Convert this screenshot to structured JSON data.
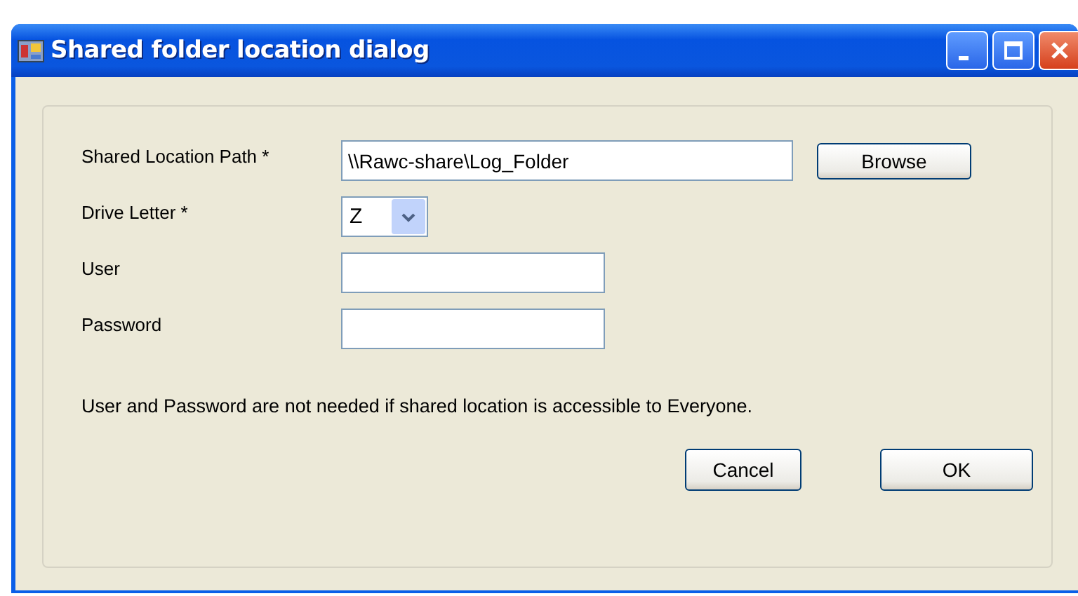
{
  "window": {
    "title": "Shared folder location dialog"
  },
  "fields": [
    {
      "label": "Shared Location Path *",
      "kind": "text",
      "value": "\\\\Rawc-share\\Log_Folder",
      "button": "Browse"
    },
    {
      "label": "Drive Letter *",
      "kind": "dropdown",
      "value": "Z"
    },
    {
      "label": "User",
      "kind": "text"
    },
    {
      "label": "Password",
      "kind": "text"
    }
  ],
  "note": "User and Password are not needed if shared location is accessible to Everyone.",
  "buttons": [
    "Cancel",
    "OK"
  ]
}
